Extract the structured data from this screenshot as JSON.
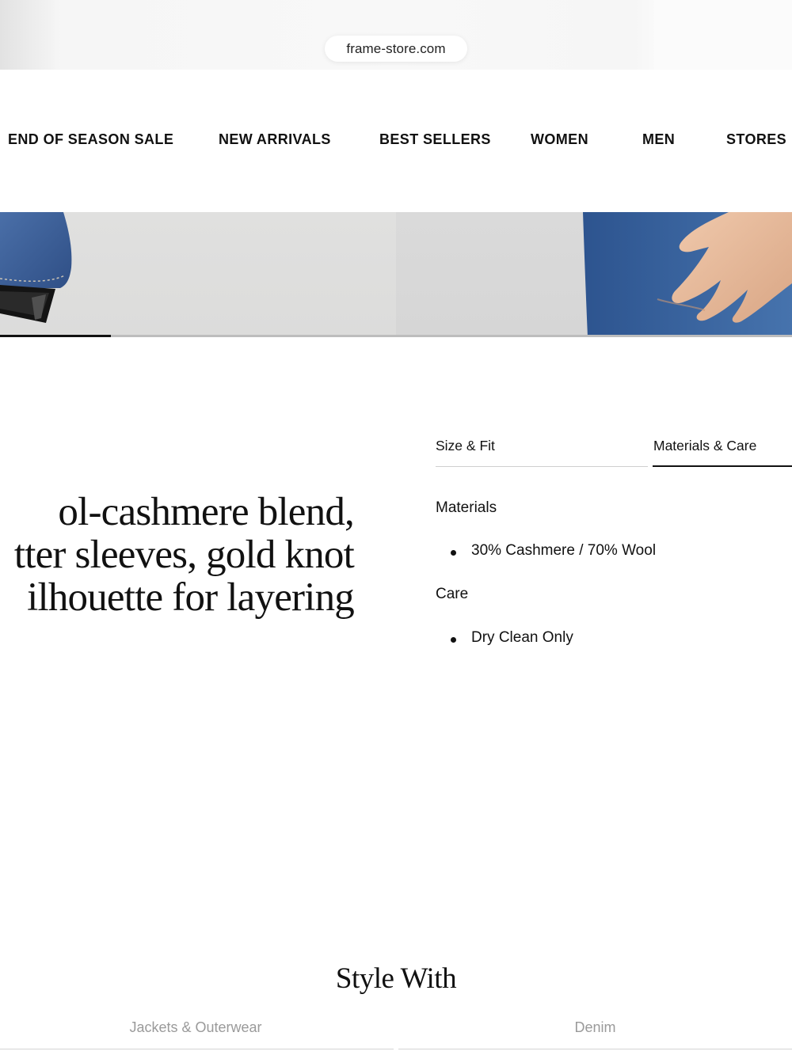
{
  "browser": {
    "url": "frame-store.com"
  },
  "nav": {
    "items": [
      {
        "label": "END OF SEASON SALE"
      },
      {
        "label": "NEW ARRIVALS"
      },
      {
        "label": "BEST SELLERS"
      },
      {
        "label": "WOMEN"
      },
      {
        "label": "MEN"
      },
      {
        "label": "STORES"
      }
    ]
  },
  "gallery": {
    "progress_fraction": 0.14
  },
  "description": {
    "lines": [
      "ol-cashmere blend,",
      "tter sleeves, gold knot",
      "ilhouette for layering"
    ]
  },
  "details": {
    "tabs": [
      {
        "label": "Size & Fit",
        "active": false
      },
      {
        "label": "Materials & Care",
        "active": true
      }
    ],
    "materials_heading": "Materials",
    "materials_items": [
      "30% Cashmere / 70% Wool"
    ],
    "care_heading": "Care",
    "care_items": [
      "Dry Clean Only"
    ]
  },
  "style_with": {
    "title": "Style With",
    "tabs": [
      {
        "label": "Jackets & Outerwear"
      },
      {
        "label": "Denim"
      }
    ]
  },
  "colors": {
    "text": "#111111",
    "muted": "#9a9a9a",
    "background": "#ffffff",
    "denim": "#3f64a0"
  }
}
